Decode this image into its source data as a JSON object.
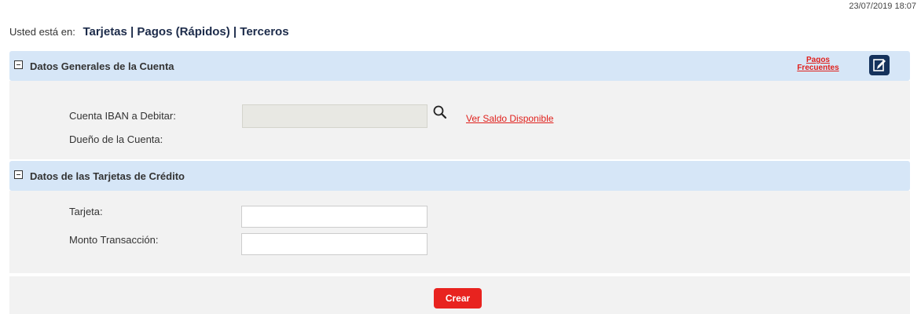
{
  "timestamp": "23/07/2019 18:07",
  "breadcrumb": {
    "prefix": "Usted está en:",
    "path": "Tarjetas | Pagos (Rápidos) | Terceros"
  },
  "account_section": {
    "title": "Datos Generales de la Cuenta",
    "pagos_frecuentes_line1": "Pagos",
    "pagos_frecuentes_line2": "Frecuentes",
    "edit_icon": "edit-icon",
    "iban_label": "Cuenta IBAN a Debitar:",
    "iban_value": "",
    "ver_saldo_link": "Ver Saldo Disponible",
    "owner_label": "Dueño de la Cuenta:",
    "owner_value": ""
  },
  "card_section": {
    "title": "Datos de las Tarjetas de Crédito",
    "tarjeta_label": "Tarjeta:",
    "tarjeta_value": "",
    "monto_label": "Monto Transacción:",
    "monto_value": ""
  },
  "actions": {
    "crear_label": "Crear"
  },
  "colors": {
    "header_bg": "#d6e6f7",
    "body_bg": "#f2f2f2",
    "link_red": "#e0201c",
    "button_red": "#e8231f",
    "navy": "#15325c"
  }
}
